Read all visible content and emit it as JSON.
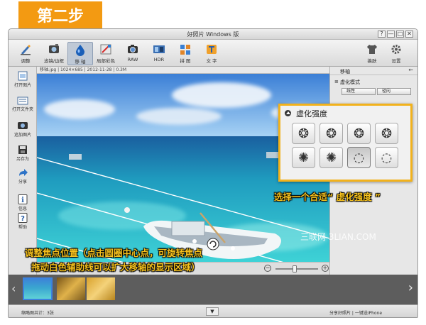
{
  "step_badge": "第二步",
  "window": {
    "title": "好照片 Windows 版",
    "controls": [
      "?",
      "—",
      "□",
      "✕"
    ]
  },
  "toolbar": {
    "items": [
      {
        "label": "调整",
        "icon": "pen-icon"
      },
      {
        "label": "滤镜/边框",
        "icon": "filter-icon"
      },
      {
        "label": "移 轴",
        "icon": "drop-icon",
        "active": true
      },
      {
        "label": "局部彩色",
        "icon": "local-color-icon"
      },
      {
        "label": "RAW",
        "icon": "raw-icon"
      },
      {
        "label": "HDR",
        "icon": "hdr-icon"
      },
      {
        "label": "拼 图",
        "icon": "collage-icon"
      },
      {
        "label": "文 字",
        "icon": "text-icon"
      }
    ],
    "right_items": [
      {
        "label": "换肤",
        "icon": "shirt-icon"
      },
      {
        "label": "设置",
        "icon": "gear-icon"
      }
    ]
  },
  "info_bar": "移轴.jpg | 1024×685 | 2012-11-28 | 0.3M",
  "left_sidebar": [
    {
      "label": "打开图片",
      "icon": "open-image-icon"
    },
    {
      "label": "打开文件夹",
      "icon": "open-folder-icon"
    },
    {
      "label": "追加图片",
      "icon": "add-image-icon"
    },
    {
      "label": "另存为",
      "icon": "save-icon"
    },
    {
      "label": "分享",
      "icon": "share-icon"
    },
    {
      "label": "信息",
      "icon": "info-icon"
    },
    {
      "label": "帮助",
      "icon": "help-icon"
    }
  ],
  "right_panel": {
    "title": "移轴",
    "section": "虚化模式",
    "mode_tabs": [
      "线性",
      "径向"
    ]
  },
  "blur_popup": {
    "title": "虚化强度",
    "options_count_label": "8"
  },
  "callouts": {
    "blur_hint": "选择一个合适“ 虚化强度 ”",
    "focus_hint_line1": "调整焦点位置（点击圆圈中心点，可旋转焦点",
    "focus_hint_line2": "拖动白色辅助线可以扩大移轴的显示区域）"
  },
  "watermark": "三联网 3LIAN.COM",
  "status_bar": {
    "left": "缩略图共计：3张",
    "right": "分享好照片 | 一键送iPhone"
  },
  "colors": {
    "accent_orange": "#f39a12",
    "callout_yellow": "#f7c21d",
    "popup_border": "#f2b21c"
  }
}
